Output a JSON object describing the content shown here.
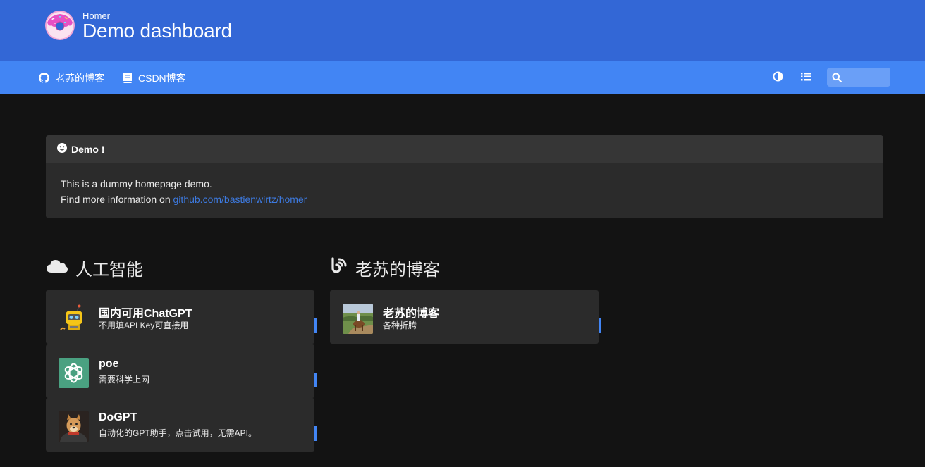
{
  "header": {
    "subtitle": "Homer",
    "title": "Demo dashboard"
  },
  "navbar": {
    "links": [
      {
        "label": "老苏的博客",
        "icon": "github-icon"
      },
      {
        "label": "CSDN博客",
        "icon": "book-icon"
      }
    ],
    "buttons": [
      {
        "name": "theme-toggle",
        "icon": "half-circle-icon"
      },
      {
        "name": "layout-toggle",
        "icon": "list-icon"
      }
    ],
    "search": {
      "placeholder": "",
      "value": "",
      "icon": "search-icon"
    }
  },
  "message": {
    "title": "Demo !",
    "icon": "smile-icon",
    "line1": "This is a dummy homepage demo.",
    "line2_prefix": "Find more information on ",
    "link_text": "github.com/bastienwirtz/homer"
  },
  "groups": [
    {
      "title": "人工智能",
      "icon": "cloud-icon",
      "items": [
        {
          "name": "国内可用ChatGPT",
          "subtitle": "不用填API Key可直接用",
          "icon": "robot-icon"
        },
        {
          "name": "poe",
          "subtitle": "需要科学上网",
          "icon": "openai-icon"
        },
        {
          "name": "DoGPT",
          "subtitle": "自动化的GPT助手，点击试用，无需API。",
          "icon": "doge-avatar-icon"
        }
      ]
    },
    {
      "title": "老苏的博客",
      "icon": "blog-icon",
      "items": [
        {
          "name": "老苏的博客",
          "subtitle": "各种折腾",
          "icon": "horse-photo-icon"
        }
      ]
    }
  ],
  "colors": {
    "header_bg": "#3367d6",
    "navbar_bg": "#4285f4",
    "page_bg": "#131313",
    "card_bg": "#2b2b2b",
    "accent": "#4285f4",
    "link": "#3d7ae0"
  }
}
